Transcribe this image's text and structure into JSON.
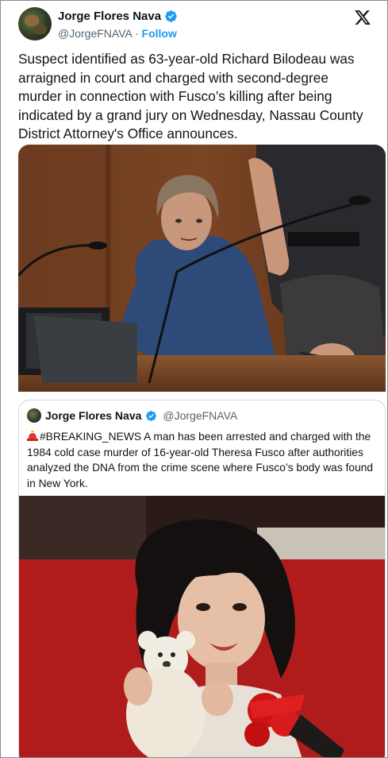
{
  "tweet": {
    "author_name": "Jorge Flores Nava",
    "handle": "@JorgeFNAVA",
    "separator": "·",
    "follow_label": "Follow",
    "text": "Suspect identified as 63-year-old Richard Bilodeau was arraigned in court and charged with second-degree murder in connection with Fusco’s killing after being indicated by a grand jury on Wednesday, Nassau County District Attorney's Office announces.",
    "photo_icon": "courtroom-photo"
  },
  "quote": {
    "author_name": "Jorge Flores Nava",
    "handle": "@JorgeFNAVA",
    "emoji_icon": "police-siren-icon",
    "text": "#BREAKING_NEWS A man has been arrested and charged with the 1984 cold case murder of 16-year-old Theresa Fusco after authorities analyzed the DNA from the crime scene where Fusco’s body was found in New York.",
    "photo_icon": "portrait-photo"
  },
  "colors": {
    "text": "#0f1419",
    "secondary": "#536471",
    "accent": "#1d9bf0",
    "border": "#cfd9de"
  }
}
